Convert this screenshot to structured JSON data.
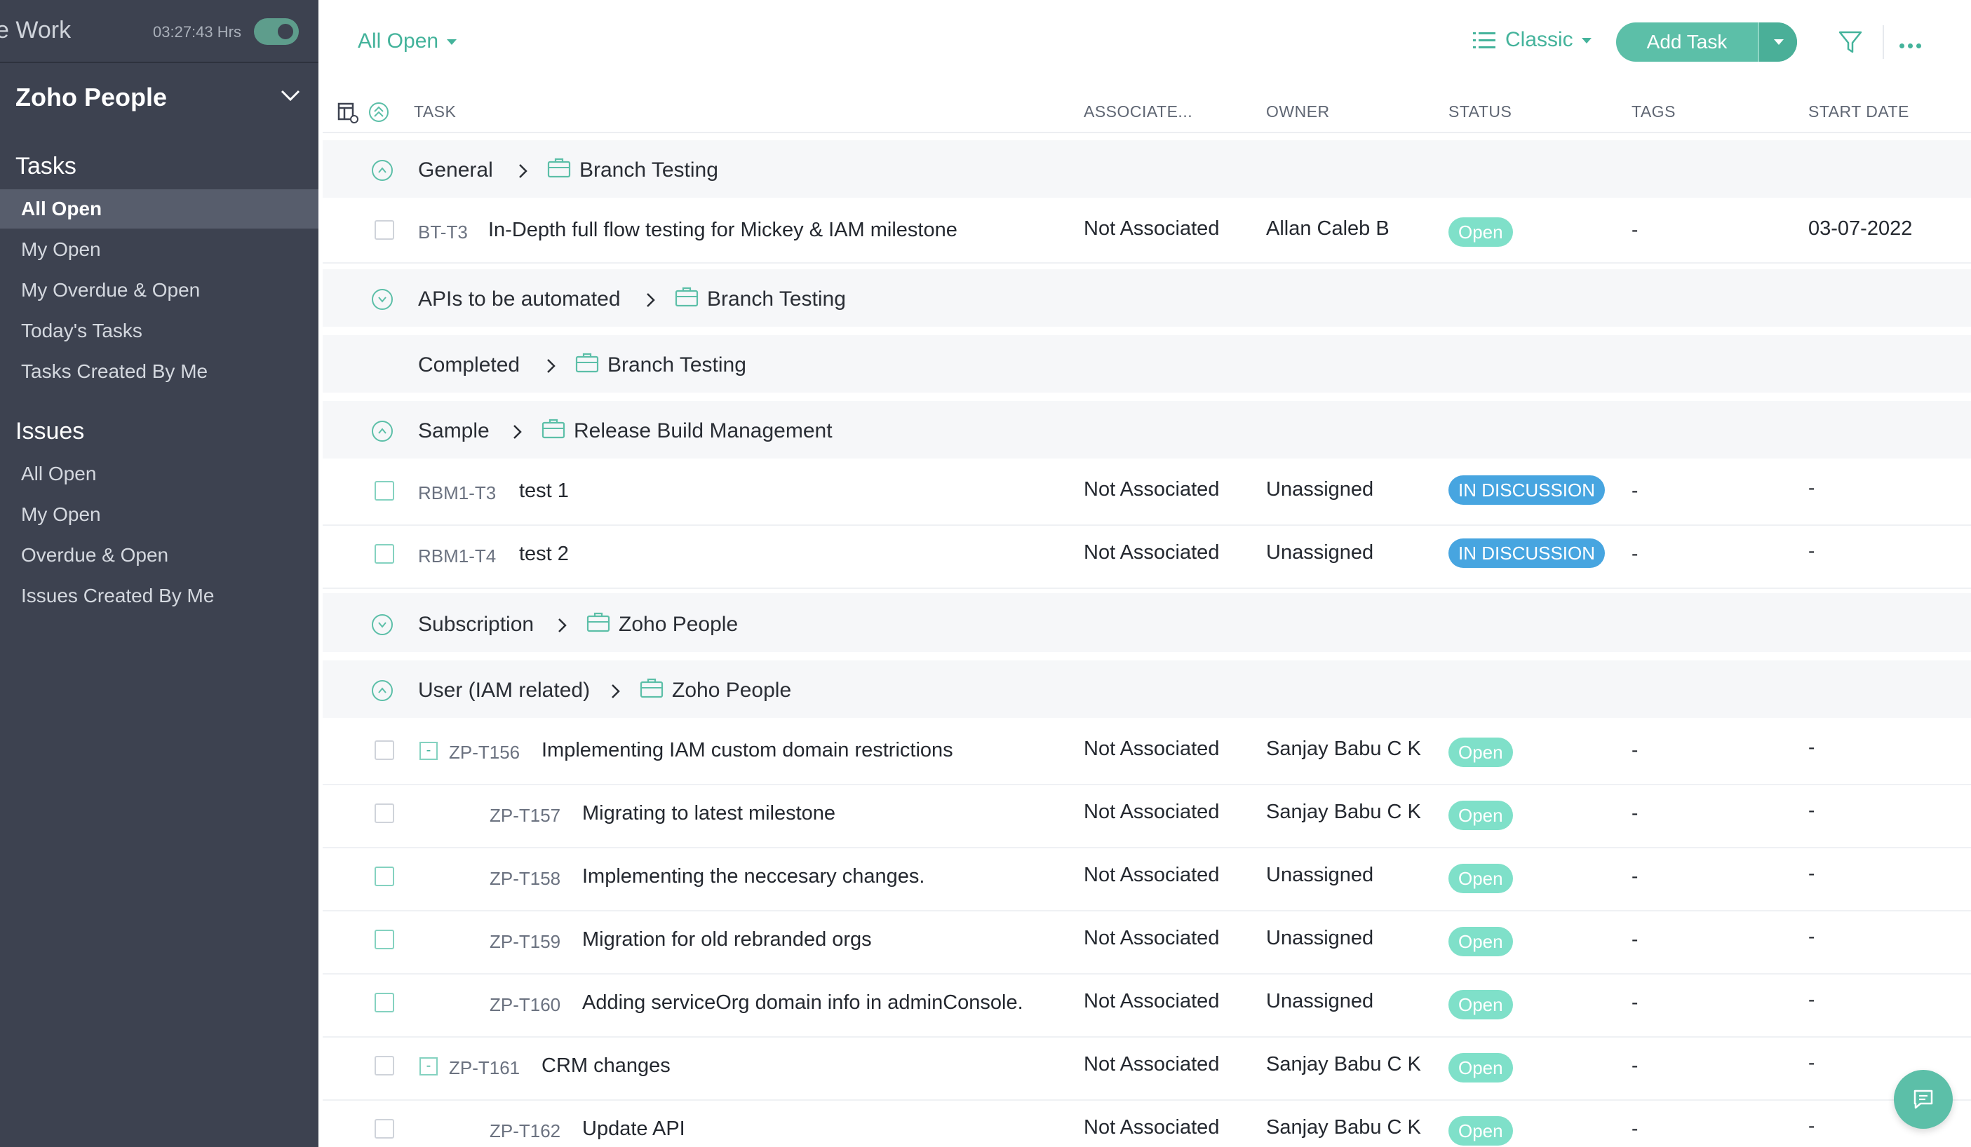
{
  "sidebar": {
    "title": "e Work",
    "timer": "03:27:43 Hrs",
    "project": "Zoho People",
    "tasks_heading": "Tasks",
    "task_items": [
      {
        "label": "All Open"
      },
      {
        "label": "My Open"
      },
      {
        "label": "My Overdue & Open"
      },
      {
        "label": "Today's Tasks"
      },
      {
        "label": "Tasks Created By Me"
      }
    ],
    "issues_heading": "Issues",
    "issue_items": [
      {
        "label": "All Open"
      },
      {
        "label": "My Open"
      },
      {
        "label": "Overdue & Open"
      },
      {
        "label": "Issues Created By Me"
      }
    ]
  },
  "toolbar": {
    "view_filter": "All Open",
    "layout": "Classic",
    "add_task": "Add Task"
  },
  "columns": {
    "task": "TASK",
    "associate": "ASSOCIATE...",
    "owner": "OWNER",
    "status": "STATUS",
    "tags": "TAGS",
    "start_date": "START DATE"
  },
  "groups": [
    {
      "name": "General",
      "project": "Branch Testing"
    },
    {
      "name": "APIs to be automated",
      "project": "Branch Testing"
    },
    {
      "name": "Completed",
      "project": "Branch Testing"
    },
    {
      "name": "Sample",
      "project": "Release Build Management"
    },
    {
      "name": "Subscription",
      "project": "Zoho People"
    },
    {
      "name": "User (IAM related)",
      "project": "Zoho People"
    }
  ],
  "tasks": [
    {
      "id": "BT-T3",
      "name": "In-Depth full flow testing for Mickey & IAM milestone",
      "associate": "Not Associated",
      "owner": "Allan Caleb B",
      "status": "Open",
      "tags": "-",
      "start": "03-07-2022"
    },
    {
      "id": "RBM1-T3",
      "name": "test 1",
      "associate": "Not Associated",
      "owner": "Unassigned",
      "status": "IN DISCUSSION",
      "tags": "-",
      "start": "-"
    },
    {
      "id": "RBM1-T4",
      "name": "test 2",
      "associate": "Not Associated",
      "owner": "Unassigned",
      "status": "IN DISCUSSION",
      "tags": "-",
      "start": "-"
    },
    {
      "id": "ZP-T156",
      "name": "Implementing IAM custom domain restrictions",
      "associate": "Not Associated",
      "owner": "Sanjay Babu C K",
      "status": "Open",
      "tags": "-",
      "start": "-",
      "expander": "-"
    },
    {
      "id": "ZP-T157",
      "name": "Migrating to latest milestone",
      "associate": "Not Associated",
      "owner": "Sanjay Babu C K",
      "status": "Open",
      "tags": "-",
      "start": "-"
    },
    {
      "id": "ZP-T158",
      "name": "Implementing the neccesary changes.",
      "associate": "Not Associated",
      "owner": "Unassigned",
      "status": "Open",
      "tags": "-",
      "start": "-"
    },
    {
      "id": "ZP-T159",
      "name": "Migration for old rebranded orgs",
      "associate": "Not Associated",
      "owner": "Unassigned",
      "status": "Open",
      "tags": "-",
      "start": "-"
    },
    {
      "id": "ZP-T160",
      "name": "Adding serviceOrg domain info in adminConsole.",
      "associate": "Not Associated",
      "owner": "Unassigned",
      "status": "Open",
      "tags": "-",
      "start": "-"
    },
    {
      "id": "ZP-T161",
      "name": "CRM changes",
      "associate": "Not Associated",
      "owner": "Sanjay Babu C K",
      "status": "Open",
      "tags": "-",
      "start": "-",
      "expander": "-"
    },
    {
      "id": "ZP-T162",
      "name": "Update API",
      "associate": "Not Associated",
      "owner": "Sanjay Babu C K",
      "status": "Open",
      "tags": "-",
      "start": "-"
    }
  ],
  "icons": {
    "collapse": "chevron-circle-icon",
    "project": "briefcase-icon",
    "filter": "funnel-icon",
    "more": "more-horizontal-icon",
    "chat": "chat-icon"
  },
  "colors": {
    "accent": "#44b39b",
    "sidebar_bg": "#3d4250",
    "open_badge": "#7fe0c9",
    "discussion_badge": "#47a5e0"
  }
}
